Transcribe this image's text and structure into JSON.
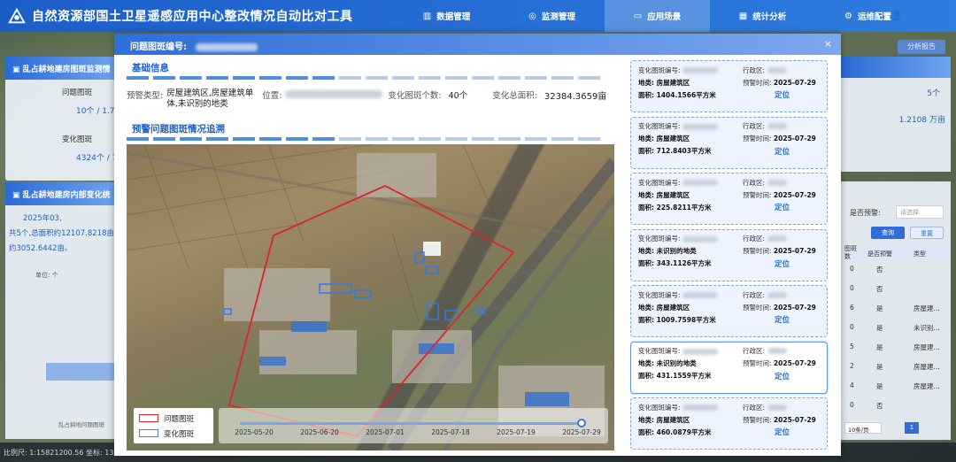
{
  "app": {
    "title": "自然资源部国土卫星遥感应用中心整改情况自动比对工具"
  },
  "nav": [
    {
      "icon": "▥",
      "label": "数据管理",
      "active": false
    },
    {
      "icon": "◎",
      "label": "监测管理",
      "active": false
    },
    {
      "icon": "▭",
      "label": "应用场景",
      "active": true
    },
    {
      "icon": "▦",
      "label": "统计分析",
      "active": false
    },
    {
      "icon": "⚙",
      "label": "运维配置",
      "active": false
    }
  ],
  "user_icon": "👤",
  "background": {
    "left_panel_title": "乱占耕地建房图斑监测情",
    "issue_label": "问题图斑",
    "issue_value": "10个 / 1.7",
    "change_label": "变化图斑",
    "change_value": "4324个 / 7",
    "left_panel2_title": "乱占耕地建房内部变化统",
    "summary_line1": "2025年03,",
    "summary_line2": "共5个,总面积约12107.8218亩,",
    "summary_line3": "约3052.6442亩。",
    "unit_label": "单位: 个",
    "axis_label": "乱占耕地问题图斑",
    "right_value1": "5个",
    "right_value2": "1.2108 万亩",
    "warning_label": "是否预警:",
    "warning_select": "请选择",
    "query_button": "查询",
    "reset_button": "重置",
    "col_count": "图斑数",
    "col_warning": "是否预警",
    "col_type": "类型",
    "table_rows": [
      [
        "0",
        "否",
        ""
      ],
      [
        "0",
        "否",
        ""
      ],
      [
        "6",
        "是",
        "房屋建..."
      ],
      [
        "0",
        "是",
        "未识别..."
      ],
      [
        "5",
        "是",
        "房屋建..."
      ],
      [
        "2",
        "是",
        "房屋建..."
      ],
      [
        "4",
        "是",
        "房屋建..."
      ],
      [
        "0",
        "否",
        ""
      ]
    ],
    "page_size": "10条/页",
    "page_num": "1",
    "analysis_button": "分析报告",
    "status_bar": "比例尺: 1:15821200.56 坐标: 137."
  },
  "modal": {
    "title": "问题图斑编号:",
    "close": "×",
    "basic_section": "基础信息",
    "warning_type_label": "预警类型:",
    "warning_type_value": "房屋建筑区,房屋建筑单体,未识别的地类",
    "position_label": "位置:",
    "change_count_label": "变化图斑个数:",
    "change_count_value": "40个",
    "total_area_label": "变化总面积:",
    "total_area_value": "32384.3659亩",
    "trace_section": "预警问题图斑情况追溯",
    "legend": [
      {
        "label": "问题图斑",
        "color": "#d8262a"
      },
      {
        "label": "变化图斑",
        "color": "#3a86e0"
      }
    ],
    "timeline": [
      "2025-05-20",
      "2025-06-20",
      "2025-07-01",
      "2025-07-18",
      "2025-07-19",
      "2025-07-29"
    ]
  },
  "cards": [
    {
      "id_label": "变化图斑编号:",
      "region_label": "行政区:",
      "type": "地类: 房屋建筑区",
      "date_label": "预警时间:",
      "date": "2025-07-29",
      "area": "面积: 1404.1566平方米",
      "action": "定位",
      "selected": false
    },
    {
      "id_label": "变化图斑编号:",
      "region_label": "行政区:",
      "type": "地类: 房屋建筑区",
      "date_label": "预警时间:",
      "date": "2025-07-29",
      "area": "面积: 712.8403平方米",
      "action": "定位",
      "selected": false
    },
    {
      "id_label": "变化图斑编号:",
      "region_label": "行政区:",
      "type": "地类: 房屋建筑区",
      "date_label": "预警时间:",
      "date": "2025-07-29",
      "area": "面积: 225.8211平方米",
      "action": "定位",
      "selected": false
    },
    {
      "id_label": "变化图斑编号:",
      "region_label": "行政区:",
      "type": "地类: 未识别的地类",
      "date_label": "预警时间:",
      "date": "2025-07-29",
      "area": "面积: 343.1126平方米",
      "action": "定位",
      "selected": false
    },
    {
      "id_label": "变化图斑编号:",
      "region_label": "行政区:",
      "type": "地类: 房屋建筑区",
      "date_label": "预警时间:",
      "date": "2025-07-29",
      "area": "面积: 1009.7598平方米",
      "action": "定位",
      "selected": false
    },
    {
      "id_label": "变化图斑编号:",
      "region_label": "行政区:",
      "type": "地类: 未识别的地类",
      "date_label": "预警时间:",
      "date": "2025-07-29",
      "area": "面积: 431.1559平方米",
      "action": "定位",
      "selected": true
    },
    {
      "id_label": "变化图斑编号:",
      "region_label": "行政区:",
      "type": "地类: 房屋建筑区",
      "date_label": "预警时间:",
      "date": "2025-07-29",
      "area": "面积: 460.0879平方米",
      "action": "定位",
      "selected": false
    }
  ]
}
